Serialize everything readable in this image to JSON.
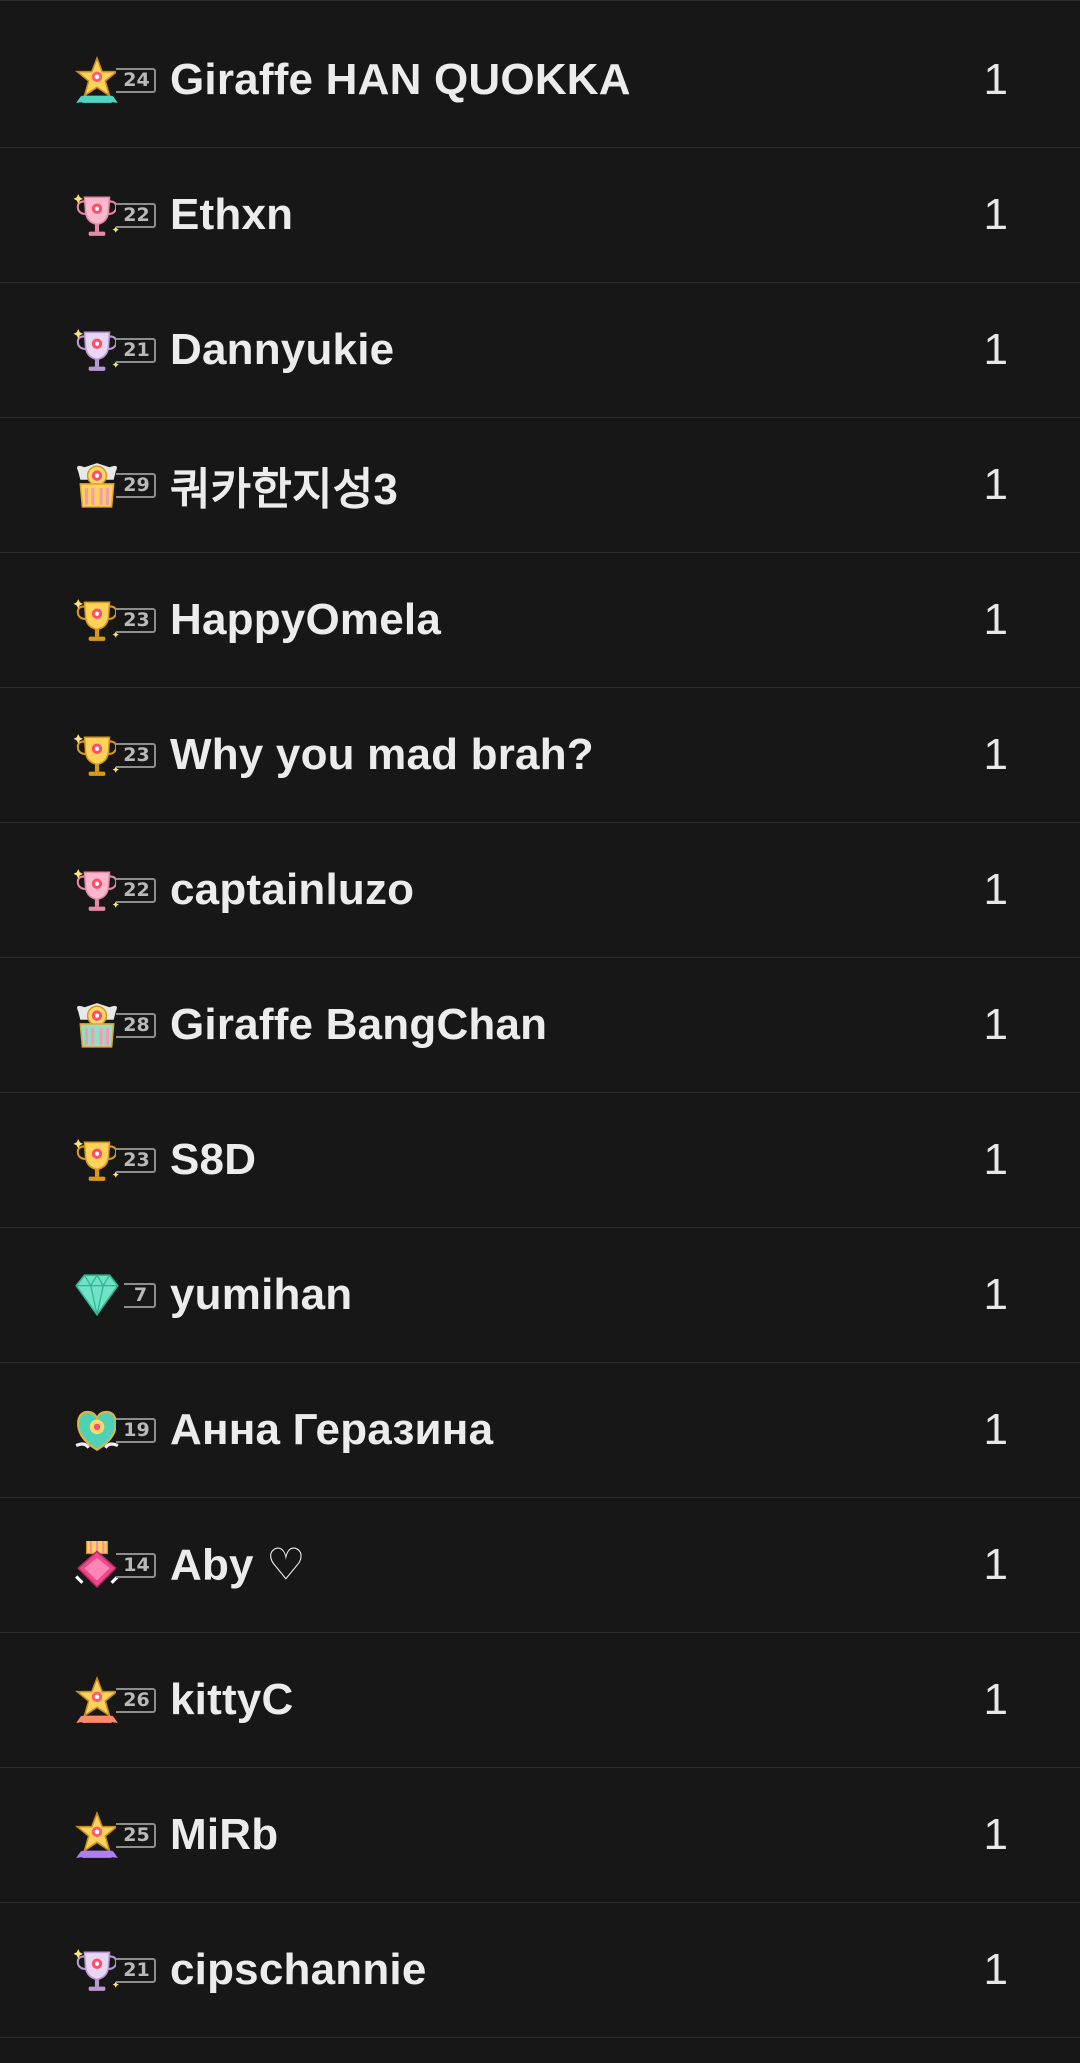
{
  "leaderboard": {
    "rows": [
      {
        "username": "Giraffe HAN QUOKKA",
        "level": "24",
        "count": "1",
        "badge": "star-teal-icon",
        "badge_color": "#5ad3c6"
      },
      {
        "username": "Ethxn",
        "level": "22",
        "count": "1",
        "badge": "trophy-pink-icon",
        "badge_color": "#f5a9c0"
      },
      {
        "username": "Dannyukie",
        "level": "21",
        "count": "1",
        "badge": "trophy-lavender-icon",
        "badge_color": "#d9bfe8"
      },
      {
        "username": "쿼카한지성3",
        "level": "29",
        "count": "1",
        "badge": "crown-flower-gold-icon",
        "badge_color": "#f6c54a"
      },
      {
        "username": "HappyOmela",
        "level": "23",
        "count": "1",
        "badge": "trophy-gold-icon",
        "badge_color": "#f5c84a"
      },
      {
        "username": "Why you mad brah?",
        "level": "23",
        "count": "1",
        "badge": "trophy-gold-icon",
        "badge_color": "#f5c84a"
      },
      {
        "username": "captainluzo",
        "level": "22",
        "count": "1",
        "badge": "trophy-pink-icon",
        "badge_color": "#f5a9c0"
      },
      {
        "username": "Giraffe BangChan",
        "level": "28",
        "count": "1",
        "badge": "crown-flower-teal-icon",
        "badge_color": "#f6c54a"
      },
      {
        "username": "S8D",
        "level": "23",
        "count": "1",
        "badge": "trophy-gold-icon",
        "badge_color": "#f5c84a"
      },
      {
        "username": "yumihan",
        "level": "7",
        "count": "1",
        "badge": "diamond-mint-icon",
        "badge_color": "#6fe3c3"
      },
      {
        "username": "Анна Геразина",
        "level": "19",
        "count": "1",
        "badge": "heart-shield-teal-icon",
        "badge_color": "#4fd1b5"
      },
      {
        "username": "Aby ♡",
        "level": "14",
        "count": "1",
        "badge": "gem-medal-pink-icon",
        "badge_color": "#f0478a"
      },
      {
        "username": "kittyC",
        "level": "26",
        "count": "1",
        "badge": "star-coral-icon",
        "badge_color": "#f7c548"
      },
      {
        "username": "MiRb",
        "level": "25",
        "count": "1",
        "badge": "star-purple-icon",
        "badge_color": "#f7c548"
      },
      {
        "username": "cipschannie",
        "level": "21",
        "count": "1",
        "badge": "trophy-lavender-icon",
        "badge_color": "#d9bfe8"
      }
    ]
  }
}
